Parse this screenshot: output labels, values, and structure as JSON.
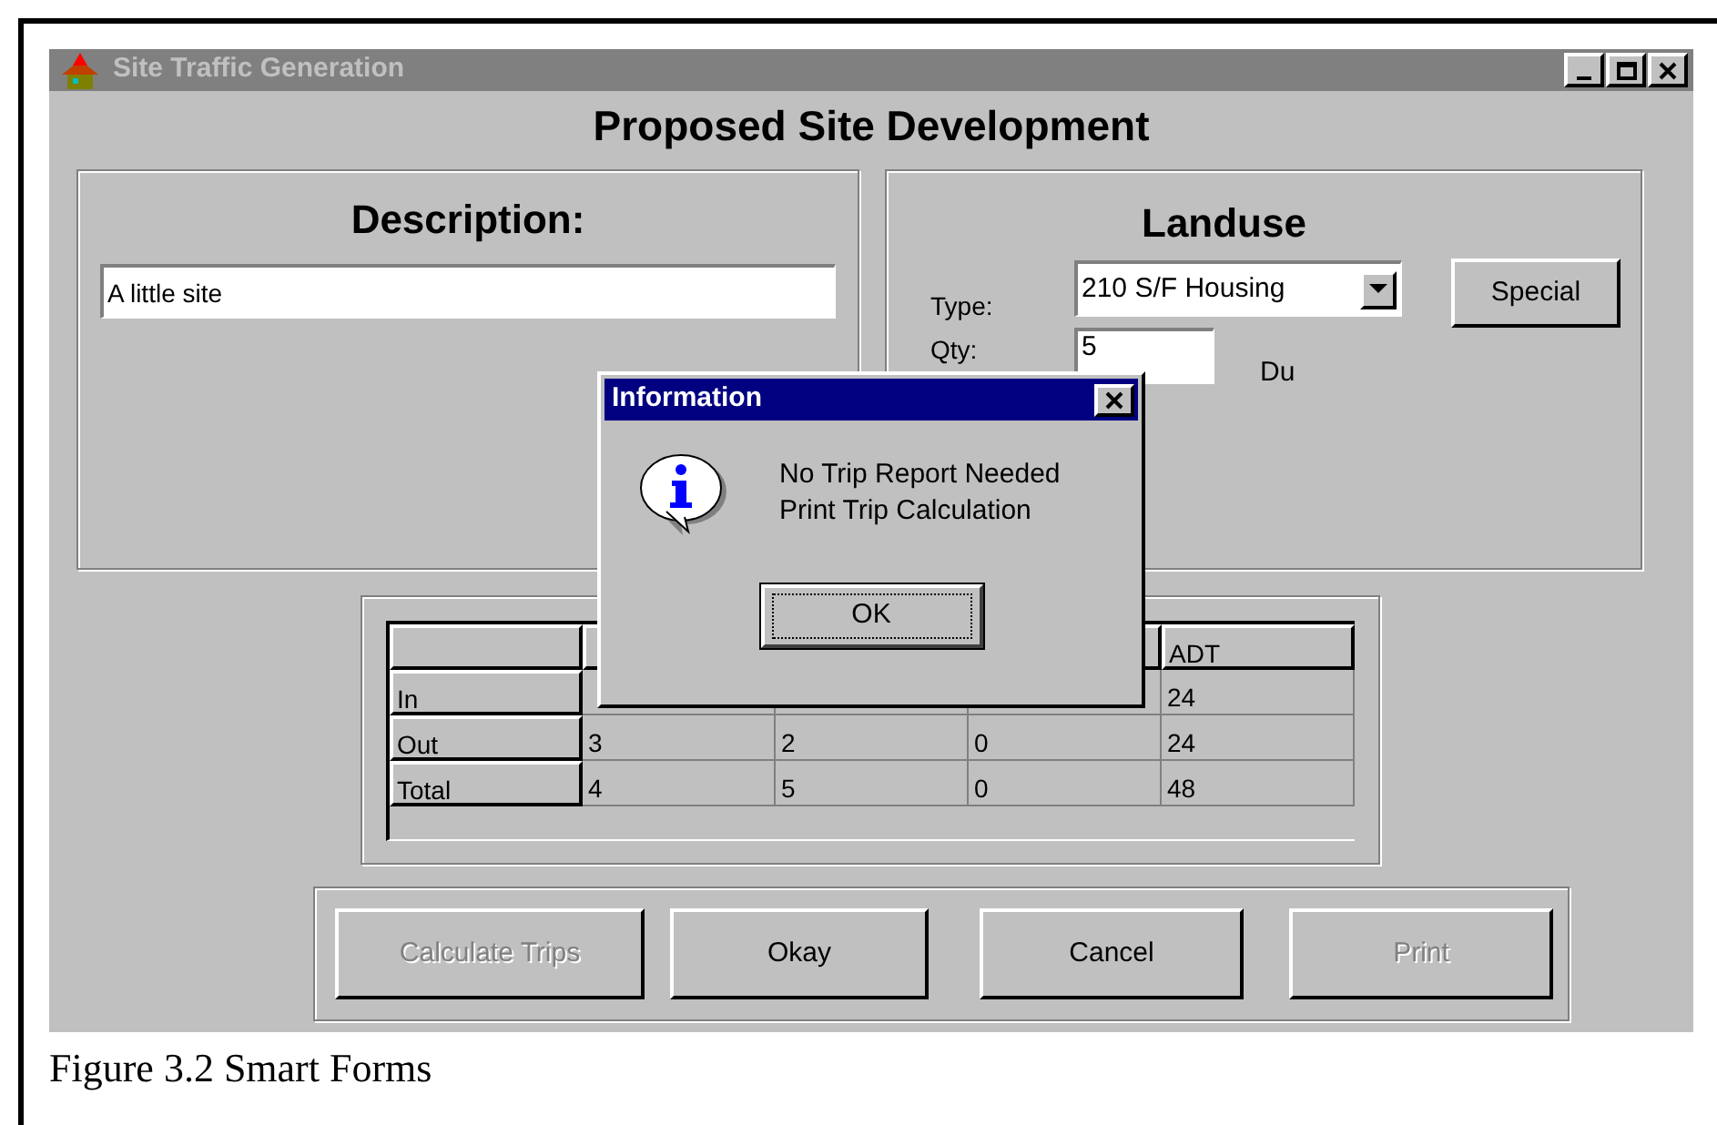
{
  "window": {
    "title": "Site Traffic Generation",
    "active": false
  },
  "heading": "Proposed Site Development",
  "description": {
    "label": "Description:",
    "value": "A little site"
  },
  "landuse": {
    "label": "Landuse",
    "type_label": "Type:",
    "type_value": "210 S/F Housing",
    "special_button": "Special",
    "qty_label": "Qty:",
    "qty_value": "5",
    "unit": "Du"
  },
  "grid": {
    "last_header": "ADT",
    "rows": [
      {
        "label": "In",
        "cells": [
          null,
          null,
          null,
          "24"
        ]
      },
      {
        "label": "Out",
        "cells": [
          "3",
          "2",
          "0",
          "24"
        ]
      },
      {
        "label": "Total",
        "cells": [
          "4",
          "5",
          "0",
          "48"
        ]
      }
    ]
  },
  "buttons": [
    {
      "label": "Calculate Trips",
      "disabled": true
    },
    {
      "label": "Okay",
      "disabled": false
    },
    {
      "label": "Cancel",
      "disabled": false
    },
    {
      "label": "Print",
      "disabled": true
    }
  ],
  "dialog": {
    "title": "Information",
    "lines": [
      "No Trip Report Needed",
      "Print Trip Calculation"
    ],
    "ok": "OK"
  },
  "caption": "Figure 3.2 Smart Forms"
}
